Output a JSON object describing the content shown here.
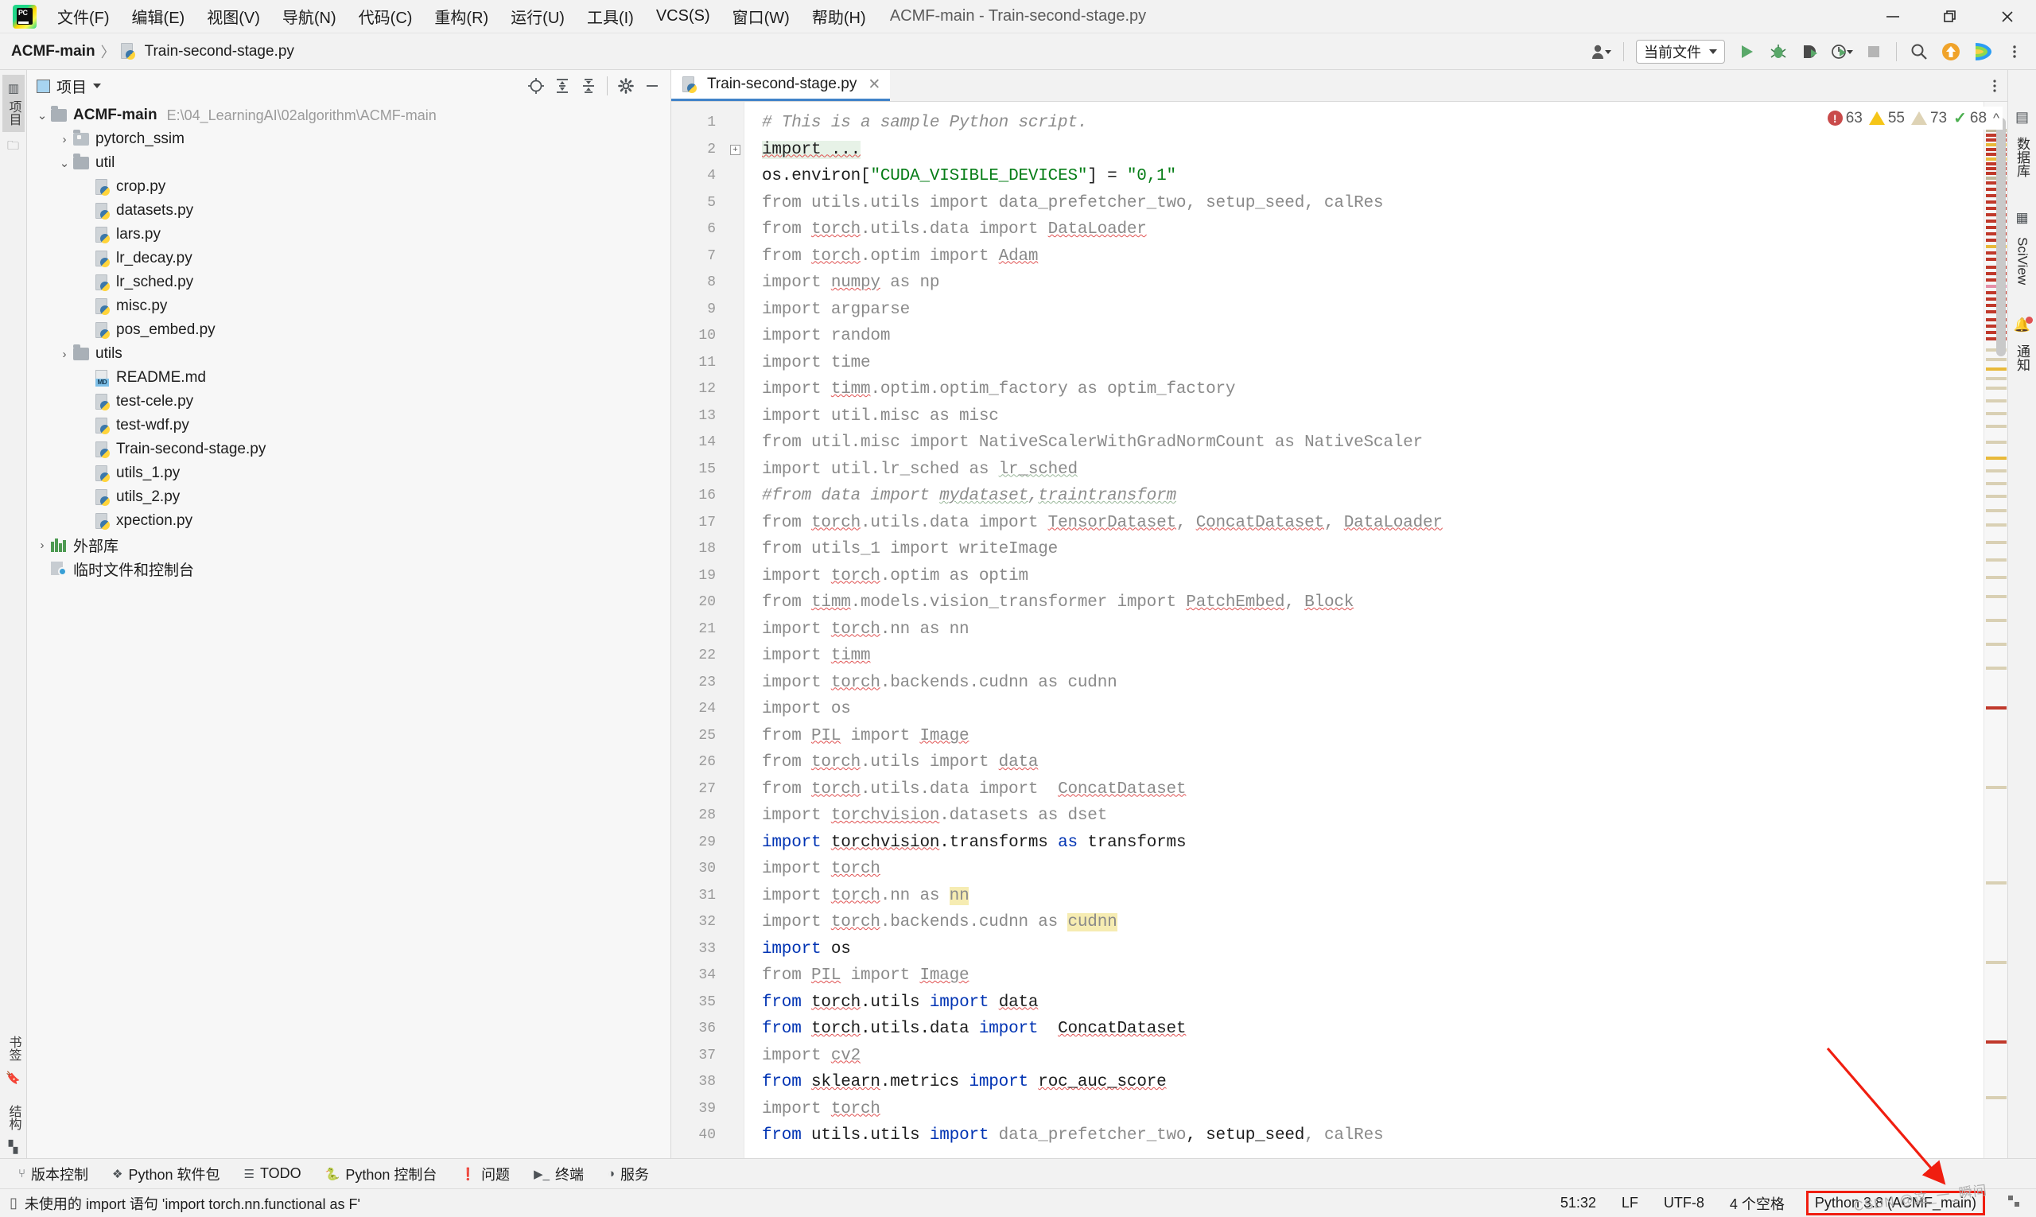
{
  "window": {
    "title": "ACMF-main - Train-second-stage.py",
    "minimize_label": "–",
    "maximize_label": "❐",
    "close_label": "✕"
  },
  "menubar": {
    "items": [
      {
        "label": "文件(F)",
        "name": "menu-file"
      },
      {
        "label": "编辑(E)",
        "name": "menu-edit"
      },
      {
        "label": "视图(V)",
        "name": "menu-view"
      },
      {
        "label": "导航(N)",
        "name": "menu-navigate"
      },
      {
        "label": "代码(C)",
        "name": "menu-code"
      },
      {
        "label": "重构(R)",
        "name": "menu-refactor"
      },
      {
        "label": "运行(U)",
        "name": "menu-run"
      },
      {
        "label": "工具(I)",
        "name": "menu-tools"
      },
      {
        "label": "VCS(S)",
        "name": "menu-vcs"
      },
      {
        "label": "窗口(W)",
        "name": "menu-window"
      },
      {
        "label": "帮助(H)",
        "name": "menu-help"
      }
    ]
  },
  "breadcrumb": {
    "root": "ACMF-main",
    "separator": "〉",
    "file": "Train-second-stage.py"
  },
  "toolbar": {
    "run_config": "当前文件",
    "icons": [
      {
        "name": "user-account-icon",
        "glyph": "👤"
      },
      {
        "name": "run-icon",
        "glyph": "▶"
      },
      {
        "name": "debug-icon",
        "glyph": "🐞"
      },
      {
        "name": "run-with-coverage-icon",
        "glyph": "▶"
      },
      {
        "name": "profile-icon",
        "glyph": "◷"
      },
      {
        "name": "stop-icon",
        "glyph": "■"
      },
      {
        "name": "search-everywhere-icon",
        "glyph": "🔍"
      },
      {
        "name": "update-project-icon",
        "glyph": "⬆"
      },
      {
        "name": "ai-assistant-icon",
        "glyph": "◗"
      }
    ]
  },
  "project_panel": {
    "title": "项目",
    "header_icons": [
      {
        "name": "select-opened-file-icon"
      },
      {
        "name": "expand-all-icon"
      },
      {
        "name": "collapse-all-icon"
      },
      {
        "name": "settings-gear-icon"
      },
      {
        "name": "hide-icon"
      }
    ],
    "tree": [
      {
        "label": "ACMF-main",
        "path": "E:\\04_LearningAI\\02algorithm\\ACMF-main",
        "type": "root",
        "indent": 0,
        "arrow": "v",
        "bold": true
      },
      {
        "label": "pytorch_ssim",
        "type": "folder-hollow",
        "indent": 1,
        "arrow": ">"
      },
      {
        "label": "util",
        "type": "folder",
        "indent": 1,
        "arrow": "v"
      },
      {
        "label": "crop.py",
        "type": "py",
        "indent": 2,
        "arrow": ""
      },
      {
        "label": "datasets.py",
        "type": "py",
        "indent": 2,
        "arrow": ""
      },
      {
        "label": "lars.py",
        "type": "py",
        "indent": 2,
        "arrow": ""
      },
      {
        "label": "lr_decay.py",
        "type": "py",
        "indent": 2,
        "arrow": ""
      },
      {
        "label": "lr_sched.py",
        "type": "py",
        "indent": 2,
        "arrow": ""
      },
      {
        "label": "misc.py",
        "type": "py",
        "indent": 2,
        "arrow": ""
      },
      {
        "label": "pos_embed.py",
        "type": "py",
        "indent": 2,
        "arrow": ""
      },
      {
        "label": "utils",
        "type": "folder",
        "indent": 1,
        "arrow": ">"
      },
      {
        "label": "README.md",
        "type": "md",
        "indent": 2,
        "arrow": ""
      },
      {
        "label": "test-cele.py",
        "type": "py",
        "indent": 2,
        "arrow": ""
      },
      {
        "label": "test-wdf.py",
        "type": "py",
        "indent": 2,
        "arrow": ""
      },
      {
        "label": "Train-second-stage.py",
        "type": "py",
        "indent": 2,
        "arrow": ""
      },
      {
        "label": "utils_1.py",
        "type": "py",
        "indent": 2,
        "arrow": ""
      },
      {
        "label": "utils_2.py",
        "type": "py",
        "indent": 2,
        "arrow": ""
      },
      {
        "label": "xpection.py",
        "type": "py",
        "indent": 2,
        "arrow": ""
      },
      {
        "label": "外部库",
        "type": "library",
        "indent": 0,
        "arrow": ">"
      },
      {
        "label": "临时文件和控制台",
        "type": "scratch",
        "indent": 0,
        "arrow": ""
      }
    ]
  },
  "editor": {
    "tab": {
      "label": "Train-second-stage.py",
      "close": "✕"
    },
    "inspections": {
      "errors": "63",
      "warnings": "55",
      "weak_warnings": "73",
      "checks": "68",
      "collapse": "^",
      "error_symbol": "!",
      "check_symbol": "✓"
    },
    "lines": [
      {
        "no": "1",
        "html": "<span class=\"cmt\"># This is a sample Python script.</span>"
      },
      {
        "no": "2",
        "html": "<span class=\"greenbg blk err\">import ...</span>",
        "fold": true
      },
      {
        "no": "4",
        "html": "<span class=\"blk\">os.environ</span><span class=\"blk\">[</span><span class=\"str\">\"CUDA_VISIBLE_DEVICES\"</span><span class=\"blk\">] = </span><span class=\"str\">\"0,1\"</span>"
      },
      {
        "no": "5",
        "html": "from utils.utils import data_prefetcher_two, setup_seed, calRes"
      },
      {
        "no": "6",
        "html": "from <span class=\"err\">torch</span>.utils.data import <span class=\"err\">DataLoader</span>"
      },
      {
        "no": "7",
        "html": "from <span class=\"err\">torch</span>.optim import <span class=\"err\">Adam</span>"
      },
      {
        "no": "8",
        "html": "import <span class=\"err\">numpy</span> as np"
      },
      {
        "no": "9",
        "html": "import argparse"
      },
      {
        "no": "10",
        "html": "import random"
      },
      {
        "no": "11",
        "html": "import time"
      },
      {
        "no": "12",
        "html": "import <span class=\"err\">timm</span>.optim.optim_factory as optim_factory"
      },
      {
        "no": "13",
        "html": "import util.misc as misc"
      },
      {
        "no": "14",
        "html": "from util.misc import NativeScalerWithGradNormCount as NativeScaler"
      },
      {
        "no": "15",
        "html": "import util.lr_sched as <span class=\"wwarn\">lr_sched</span>"
      },
      {
        "no": "16",
        "html": "<span class=\"cmt\">#from data import <span class=\"wwarn\">mydataset</span>,<span class=\"wwarn\">traintransform</span></span>"
      },
      {
        "no": "17",
        "html": "from <span class=\"err\">torch</span>.utils.data import <span class=\"err\">TensorDataset</span>, <span class=\"err\">ConcatDataset</span>, <span class=\"err\">DataLoader</span>"
      },
      {
        "no": "18",
        "html": "from utils_1 import writeImage"
      },
      {
        "no": "19",
        "html": "import <span class=\"err\">torch</span>.optim as optim"
      },
      {
        "no": "20",
        "html": "from <span class=\"err\">timm</span>.models.vision_transformer import <span class=\"err\">PatchEmbed</span>, <span class=\"err\">Block</span>"
      },
      {
        "no": "21",
        "html": "import <span class=\"err\">torch</span>.nn as nn"
      },
      {
        "no": "22",
        "html": "import <span class=\"err\">timm</span>"
      },
      {
        "no": "23",
        "html": "import <span class=\"err\">torch</span>.backends.cudnn as cudnn"
      },
      {
        "no": "24",
        "html": "import os"
      },
      {
        "no": "25",
        "html": "from <span class=\"err\">PIL</span> import <span class=\"err\">Image</span>"
      },
      {
        "no": "26",
        "html": "from <span class=\"err\">torch</span>.utils import <span class=\"err\">data</span>"
      },
      {
        "no": "27",
        "html": "from <span class=\"err\">torch</span>.utils.data import  <span class=\"err\">ConcatDataset</span>"
      },
      {
        "no": "28",
        "html": "import <span class=\"err\">torchvision</span>.datasets as dset"
      },
      {
        "no": "29",
        "html": "<span class=\"kw\">import</span> <span class=\"blk err\">torchvision</span><span class=\"blk\">.transforms</span> <span class=\"kw\">as</span> <span class=\"blk\">transforms</span>"
      },
      {
        "no": "30",
        "html": "import <span class=\"err\">torch</span>"
      },
      {
        "no": "31",
        "html": "import <span class=\"err\">torch</span>.nn as <span class=\"hl\">nn</span>"
      },
      {
        "no": "32",
        "html": "import <span class=\"err\">torch</span>.backends.cudnn as <span class=\"hl\">cudnn</span>"
      },
      {
        "no": "33",
        "html": "<span class=\"kw\">import</span> <span class=\"blk\">os</span>"
      },
      {
        "no": "34",
        "html": "from <span class=\"err\">PIL</span> import <span class=\"err\">Image</span>"
      },
      {
        "no": "35",
        "html": "<span class=\"kw\">from</span> <span class=\"blk err\">torch</span><span class=\"blk\">.utils</span> <span class=\"kw\">import</span> <span class=\"blk err\">data</span>"
      },
      {
        "no": "36",
        "html": "<span class=\"kw\">from</span> <span class=\"blk err\">torch</span><span class=\"blk\">.utils.data</span> <span class=\"kw\">import</span>  <span class=\"blk err\">ConcatDataset</span>"
      },
      {
        "no": "37",
        "html": "import <span class=\"err\">cv2</span>"
      },
      {
        "no": "38",
        "html": "<span class=\"kw\">from</span> <span class=\"blk err\">sklearn</span><span class=\"blk\">.metrics</span> <span class=\"kw\">import</span> <span class=\"blk err\">roc_auc_score</span>"
      },
      {
        "no": "39",
        "html": "import <span class=\"err\">torch</span>"
      },
      {
        "no": "40",
        "html": "<span class=\"kw\">from</span> <span class=\"blk\">utils.utils</span> <span class=\"kw\">import</span> data_prefetcher_two<span class=\"blk\">, </span><span class=\"blk\">setup_seed</span>, calRes"
      }
    ]
  },
  "left_strip": {
    "top": [
      {
        "label": "项目",
        "name": "tool-window-project"
      }
    ],
    "bottom": [
      {
        "label": "书签",
        "name": "tool-window-bookmarks"
      },
      {
        "label": "结构",
        "name": "tool-window-structure"
      }
    ]
  },
  "right_strip": {
    "items": [
      {
        "label": "数据库",
        "name": "tool-window-database"
      },
      {
        "label": "SciView",
        "name": "tool-window-sciview"
      },
      {
        "label": "通知",
        "name": "tool-window-notifications"
      }
    ]
  },
  "bottom_bar": {
    "items": [
      {
        "label": "版本控制",
        "name": "tool-window-version-control",
        "icon": "branch-icon"
      },
      {
        "label": "Python 软件包",
        "name": "tool-window-python-packages",
        "icon": "packages-icon"
      },
      {
        "label": "TODO",
        "name": "tool-window-todo",
        "icon": "todo-icon"
      },
      {
        "label": "Python 控制台",
        "name": "tool-window-python-console",
        "icon": "python-icon"
      },
      {
        "label": "问题",
        "name": "tool-window-problems",
        "icon": "problems-icon"
      },
      {
        "label": "终端",
        "name": "tool-window-terminal",
        "icon": "terminal-icon"
      },
      {
        "label": "服务",
        "name": "tool-window-services",
        "icon": "services-icon"
      }
    ]
  },
  "status_bar": {
    "message": "未使用的 import 语句 'import torch.nn.functional as F'",
    "caret_position": "51:32",
    "line_separator": "LF",
    "encoding": "UTF-8",
    "indent": "4 个空格",
    "interpreter": "Python 3.8 (ACMF_main)"
  },
  "annotations": {
    "highlight_color": "#f01e10",
    "watermark": "CSDN @这_一_瞬间"
  }
}
